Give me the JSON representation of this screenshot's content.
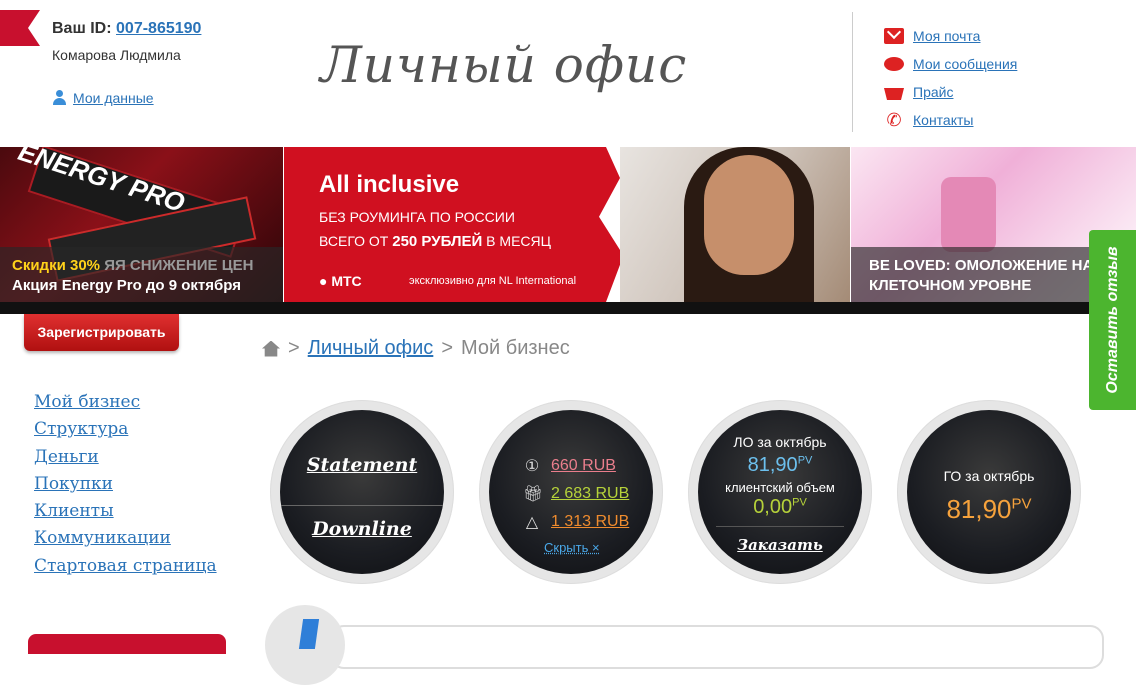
{
  "header": {
    "id_label": "Ваш ID:",
    "id_value": "007-865190",
    "user_name": "Комарова Людмила",
    "my_data": "Мои данные",
    "title": "Личный офис"
  },
  "top_links": [
    {
      "label": "Моя почта",
      "icon": "mail-icon"
    },
    {
      "label": "Мои сообщения",
      "icon": "message-icon"
    },
    {
      "label": "Прайс",
      "icon": "basket-icon"
    },
    {
      "label": "Контакты",
      "icon": "phone-icon"
    }
  ],
  "banners": {
    "b1": {
      "art_text": "ENERGY PRO",
      "line1_a": "Скидки 30%",
      "line1_b": "ЯЯ СНИЖЕНИЕ ЦЕН",
      "line2": "Акция Energy Pro до 9 октября"
    },
    "b2": {
      "title": "All inclusive",
      "line1": "БЕЗ РОУМИНГА ПО РОССИИ",
      "line2_a": "ВСЕГО ОТ ",
      "line2_b": "250 РУБЛЕЙ",
      "line2_c": " В МЕСЯЦ",
      "brand": "● МТС",
      "note": "эксклюзивно для NL International"
    },
    "b3": {
      "line1": "BE LOVED: ОМОЛОЖЕНИЕ НА",
      "line2": "КЛЕТОЧНОМ УРОВНЕ"
    }
  },
  "feedback": "Оставить отзыв",
  "register": "Зарегистрировать",
  "breadcrumb": {
    "sep": ">",
    "link": "Личный офис",
    "current": "Мой бизнес"
  },
  "sidenav": [
    "Мой бизнес",
    "Структура",
    "Деньги",
    "Покупки",
    "Клиенты",
    "Коммуникации",
    "Стартовая страница"
  ],
  "circles": {
    "c1": {
      "statement": "Statement",
      "downline": "Downline"
    },
    "c2": {
      "items": [
        {
          "icon": "coin-icon",
          "value": "660 RUB",
          "color": "#ea7e8c"
        },
        {
          "icon": "gift-icon",
          "value": "2 683 RUB",
          "color": "#b6d23a"
        },
        {
          "icon": "triangle-icon",
          "value": "1 313 RUB",
          "color": "#f08c2e"
        }
      ],
      "hide": "Скрыть ×"
    },
    "c3": {
      "lo_label": "ЛО за октябрь",
      "lo_value": "81,90",
      "client_label": "клиентский объем",
      "client_value": "0,00",
      "unit": "PV",
      "order": "Заказать"
    },
    "c4": {
      "go_label": "ГО за октябрь",
      "go_value": "81,90",
      "unit": "PV"
    }
  }
}
